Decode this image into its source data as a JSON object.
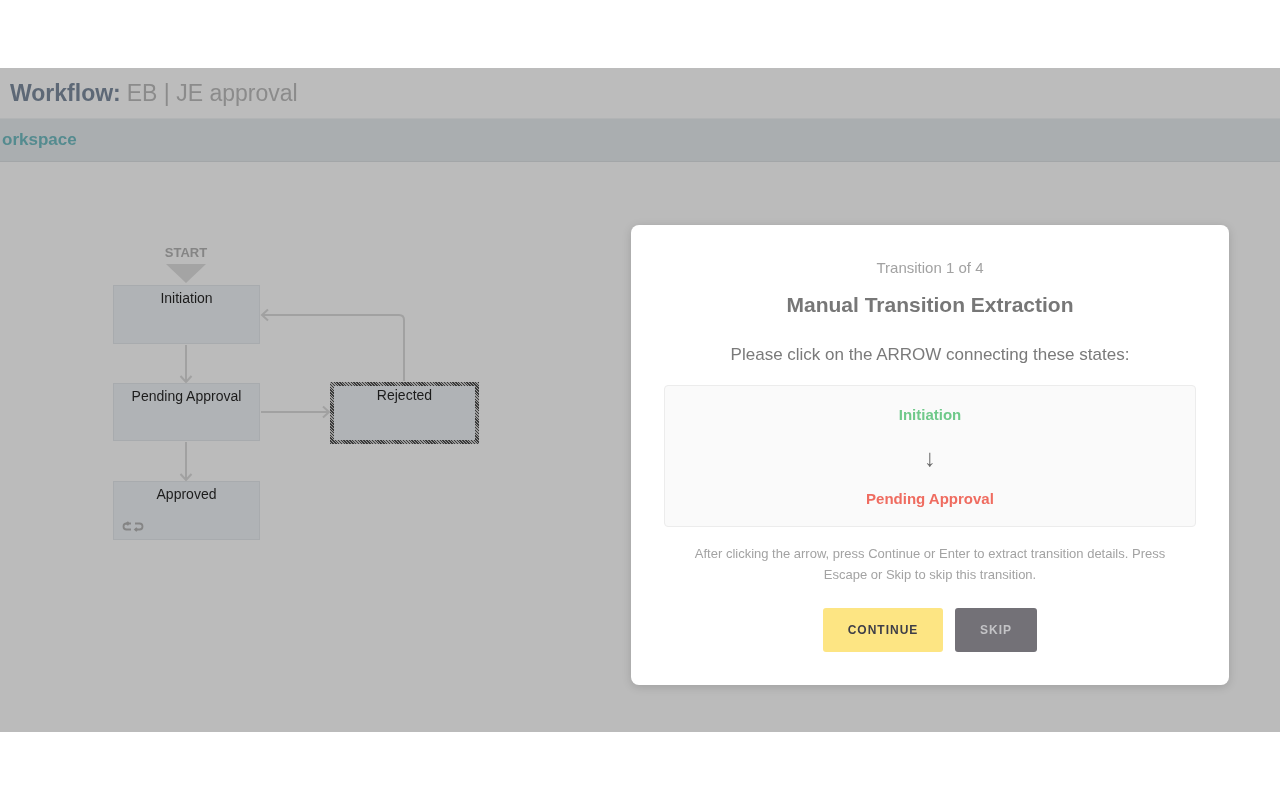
{
  "page_header": {
    "label": "Workflow:",
    "name": "EB | JE approval"
  },
  "section_bar": {
    "title": "orkspace"
  },
  "diagram": {
    "start_label": "START",
    "states": [
      {
        "name": "Initiation",
        "selected": false,
        "loop_icon": false
      },
      {
        "name": "Pending Approval",
        "selected": false,
        "loop_icon": false
      },
      {
        "name": "Approved",
        "selected": false,
        "loop_icon": true
      },
      {
        "name": "Rejected",
        "selected": true,
        "loop_icon": false
      }
    ]
  },
  "dialog": {
    "counter": "Transition 1 of 4",
    "title": "Manual Transition Extraction",
    "instruction": "Please click on the ARROW connecting these states:",
    "from_state": "Initiation",
    "direction_arrow": "↓",
    "to_state": "Pending Approval",
    "help": "After clicking the arrow, press Continue or Enter to extract transition details. Press Escape or Skip to skip this transition.",
    "buttons": [
      {
        "label": "CONTINUE",
        "kind": "primary"
      },
      {
        "label": "SKIP",
        "kind": "secondary"
      }
    ]
  }
}
